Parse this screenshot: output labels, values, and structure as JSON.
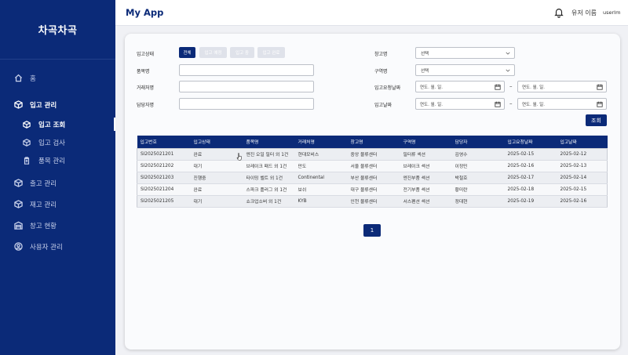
{
  "sidebar": {
    "brand": "차곡차곡",
    "items": [
      {
        "label": "홈",
        "icon": "home-icon"
      },
      {
        "label": "입고 관리",
        "icon": "box-icon"
      },
      {
        "label": "입고 조회",
        "icon": "box-icon"
      },
      {
        "label": "입고 검사",
        "icon": "box-icon"
      },
      {
        "label": "품목 관리",
        "icon": "clipboard-icon"
      },
      {
        "label": "출고 관리",
        "icon": "box-icon"
      },
      {
        "label": "재고 관리",
        "icon": "box-icon"
      },
      {
        "label": "창고 현황",
        "icon": "warehouse-icon"
      },
      {
        "label": "사용자 관리",
        "icon": "user-icon"
      }
    ]
  },
  "header": {
    "title": "My App",
    "user_name": "유저 이름",
    "avatar_alt": "userImage"
  },
  "filters": {
    "status_label": "입고상태",
    "status_options": [
      "전체",
      "입고 예정",
      "입고 중",
      "입고 완료"
    ],
    "item_label": "품목명",
    "vendor_label": "거래처명",
    "manager_label": "담당자명",
    "warehouse_label": "창고명",
    "warehouse_value": "선택",
    "zone_label": "구역명",
    "zone_value": "선택",
    "req_date_label": "입고요청날짜",
    "in_date_label": "입고날짜",
    "date_placeholder": "연도. 월. 일.",
    "range_sep": "–",
    "search_button": "조회"
  },
  "table": {
    "columns": [
      "입고번호",
      "입고상태",
      "품목명",
      "거래처명",
      "창고명",
      "구역명",
      "담당자",
      "입고요청날짜",
      "입고날짜"
    ],
    "rows": [
      [
        "SI2025021201",
        "완료",
        "엔진 오일 필터 외 1건",
        "현대모비스",
        "중앙 물류센터",
        "필터류 섹션",
        "김영수",
        "2025-02-15",
        "2025-02-12"
      ],
      [
        "SI2025021202",
        "대기",
        "브레이크 패드 외 1건",
        "만도",
        "서울 물류센터",
        "브레이크 섹션",
        "이정민",
        "2025-02-16",
        "2025-02-13"
      ],
      [
        "SI2025021203",
        "진행중",
        "타이밍 벨트 외 1건",
        "Continental",
        "부산 물류센터",
        "엔진부품 섹션",
        "박철호",
        "2025-02-17",
        "2025-02-14"
      ],
      [
        "SI2025021204",
        "완료",
        "스파크 플러그 외 1건",
        "보쉬",
        "대구 물류센터",
        "전기부품 섹션",
        "황미란",
        "2025-02-18",
        "2025-02-15"
      ],
      [
        "SI2025021205",
        "대기",
        "쇼크업소버 외 1건",
        "KYB",
        "인천 물류센터",
        "서스펜션 섹션",
        "정대현",
        "2025-02-19",
        "2025-02-16"
      ]
    ]
  },
  "pagination": {
    "current": "1"
  },
  "colors": {
    "primary": "#0b2a78",
    "inactive": "#dfe2ea"
  }
}
